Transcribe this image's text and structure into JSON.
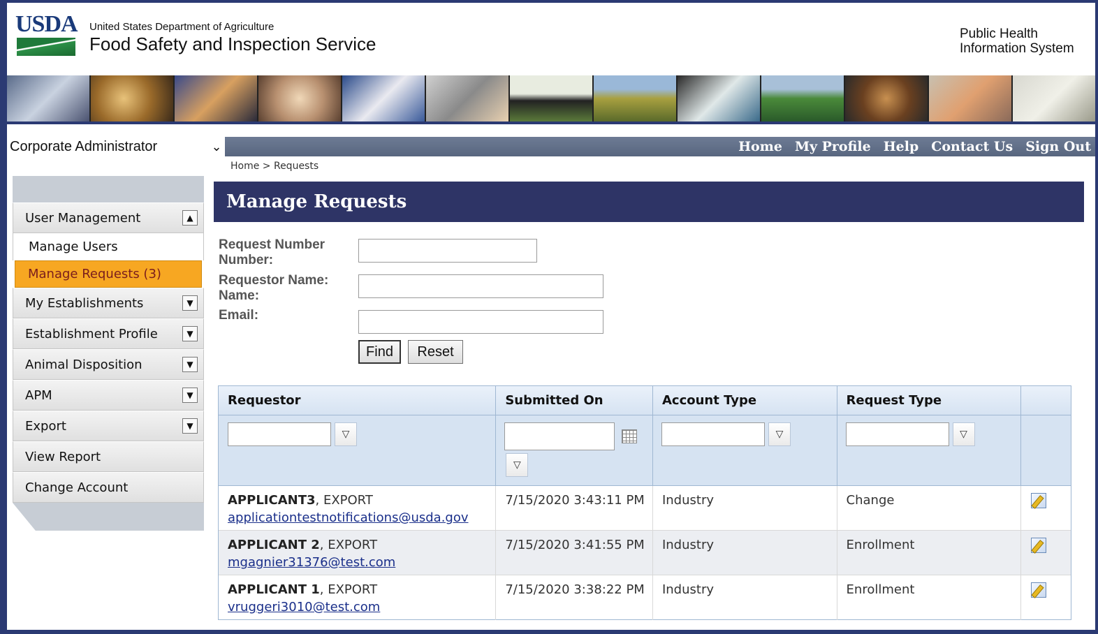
{
  "header": {
    "logo_text": "USDA",
    "agency_parent": "United States Department of Agriculture",
    "agency_name": "Food Safety and Inspection Service",
    "system_name_line1": "Public Health",
    "system_name_line2": "Information System"
  },
  "role": {
    "label": "Corporate Administrator"
  },
  "topnav": {
    "home": "Home",
    "profile": "My Profile",
    "help": "Help",
    "contact": "Contact Us",
    "signout": "Sign Out"
  },
  "breadcrumb": "Home > Requests",
  "sidebar": {
    "items": [
      {
        "label": "User Management"
      },
      {
        "label": "Manage Users"
      },
      {
        "label": "Manage Requests (3)"
      },
      {
        "label": "My Establishments"
      },
      {
        "label": "Establishment Profile"
      },
      {
        "label": "Animal Disposition"
      },
      {
        "label": "APM"
      },
      {
        "label": "Export"
      },
      {
        "label": "View Report"
      },
      {
        "label": "Change Account"
      }
    ]
  },
  "page": {
    "title": "Manage Requests"
  },
  "form": {
    "request_number_label_1": "Request Number",
    "request_number_label_2": "Number:",
    "requestor_name_label_1": "Requestor Name:",
    "requestor_name_label_2": "Name:",
    "email_label": "Email:",
    "request_number_value": "",
    "requestor_name_value": "",
    "email_value": "",
    "find_label": "Find",
    "reset_label": "Reset"
  },
  "grid": {
    "columns": [
      "Requestor",
      "Submitted On",
      "Account Type",
      "Request Type"
    ],
    "rows": [
      {
        "name": "APPLICANT3",
        "suffix": ", EXPORT",
        "email": "applicationtestnotifications@usda.gov",
        "submitted": "7/15/2020 3:43:11 PM",
        "account_type": "Industry",
        "request_type": "Change"
      },
      {
        "name": "APPLICANT 2",
        "suffix": ", EXPORT",
        "email": "mgagnier31376@test.com",
        "submitted": "7/15/2020 3:41:55 PM",
        "account_type": "Industry",
        "request_type": "Enrollment"
      },
      {
        "name": "APPLICANT 1",
        "suffix": ", EXPORT",
        "email": "vruggeri3010@test.com",
        "submitted": "7/15/2020 3:38:22 PM",
        "account_type": "Industry",
        "request_type": "Enrollment"
      }
    ]
  },
  "colors": {
    "brand_navy": "#2e3466",
    "nav_gray": "#6d7b94",
    "active_orange": "#f7a722",
    "link_blue": "#1a2f8a"
  }
}
